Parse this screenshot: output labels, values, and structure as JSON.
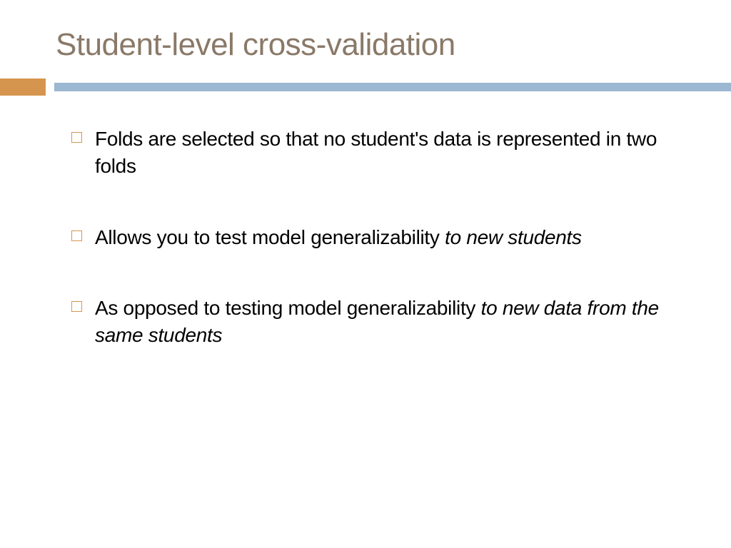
{
  "title": "Student-level cross-validation",
  "bullets": [
    {
      "text": "Folds are selected so that no student's data is represented in two folds",
      "italic": null
    },
    {
      "text": "Allows you to test model generalizability ",
      "italic": "to new students"
    },
    {
      "text": "As opposed to testing model generalizability ",
      "italic": "to new data from the same students"
    }
  ],
  "colors": {
    "title": "#8a7968",
    "accent_orange": "#d6954e",
    "accent_blue": "#9bb7d1"
  }
}
